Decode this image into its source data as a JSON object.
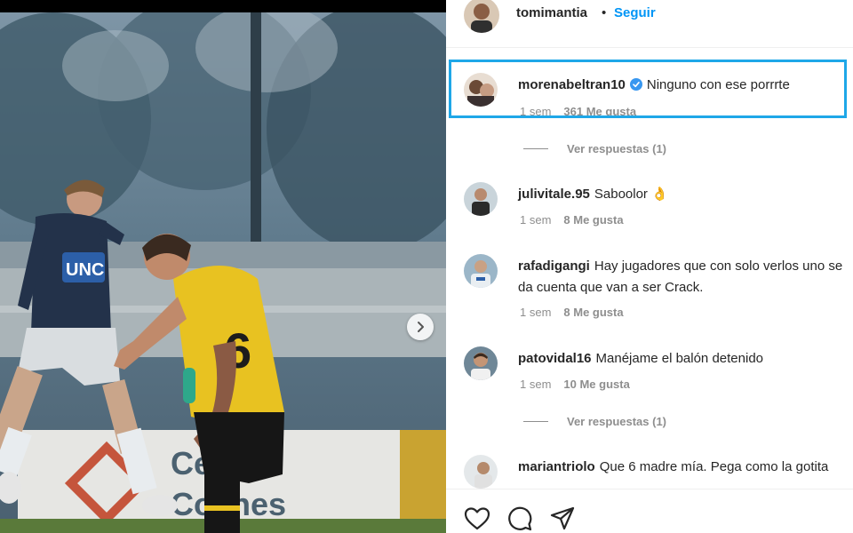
{
  "post": {
    "author": "tomimantia",
    "separator": "•",
    "follow_label": "Seguir"
  },
  "media": {
    "banner_text_1": "Ce   ica",
    "banner_text_2": "Co  ines",
    "jersey_sponsor": "UNC",
    "jersey_number": "6"
  },
  "comments": [
    {
      "username": "morenabeltran10",
      "verified": true,
      "text": "Ninguno con ese porrrte",
      "time": "1 sem",
      "likes": "361 Me gusta",
      "replies": "Ver respuestas (1)"
    },
    {
      "username": "julivitale.95",
      "text": "Saboolor 👌",
      "time": "1 sem",
      "likes": "8 Me gusta"
    },
    {
      "username": "rafadigangi",
      "text": "Hay jugadores que con solo verlos uno se da cuenta que van a ser Crack.",
      "time": "1 sem",
      "likes": "8 Me gusta"
    },
    {
      "username": "patovidal16",
      "text": "Manéjame el balón detenido",
      "time": "1 sem",
      "likes": "10 Me gusta",
      "replies": "Ver respuestas (1)"
    },
    {
      "username": "mariantriolo",
      "text": "Que 6 madre mía. Pega como la gotita"
    }
  ],
  "icons": {
    "like": "heart-icon",
    "comment": "comment-icon",
    "share": "share-icon",
    "next": "chevron-right-icon"
  },
  "colors": {
    "accent": "#0095f6",
    "highlight": "#1ea7e8",
    "muted": "#8e8e8e"
  }
}
